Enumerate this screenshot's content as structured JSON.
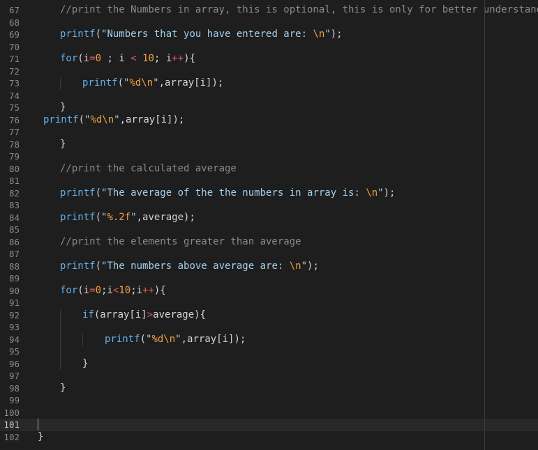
{
  "editor": {
    "colors": {
      "background": "#1e1e1e",
      "line_number": "#8a8a8a",
      "current_line": "#282828",
      "indent_guide": "#3a3a3a",
      "comment": "#8a8a8a",
      "function": "#64b0ea",
      "string": "#a3cfec",
      "escape_and_format": "#f0a040",
      "operator": "#e05c5c",
      "plain": "#d4d4d4"
    },
    "current_line": 101,
    "lines": [
      {
        "n": 67,
        "indent": 1,
        "tokens": [
          {
            "t": "//print the Numbers in array, this is optional, this is only for better understanding",
            "k": "comment"
          }
        ]
      },
      {
        "n": 68,
        "indent": 1,
        "tokens": []
      },
      {
        "n": 69,
        "indent": 1,
        "tokens": [
          {
            "t": "printf",
            "k": "function"
          },
          {
            "t": "(",
            "k": "plain"
          },
          {
            "t": "\"Numbers that you have entered are: ",
            "k": "string"
          },
          {
            "t": "\\n",
            "k": "escape_and_format"
          },
          {
            "t": "\"",
            "k": "string"
          },
          {
            "t": ");",
            "k": "plain"
          }
        ]
      },
      {
        "n": 70,
        "indent": 1,
        "tokens": []
      },
      {
        "n": 71,
        "indent": 1,
        "tokens": [
          {
            "t": "for",
            "k": "function"
          },
          {
            "t": "(i",
            "k": "plain"
          },
          {
            "t": "=",
            "k": "operator"
          },
          {
            "t": "0",
            "k": "escape_and_format"
          },
          {
            "t": " ; i ",
            "k": "plain"
          },
          {
            "t": "<",
            "k": "operator"
          },
          {
            "t": " ",
            "k": "plain"
          },
          {
            "t": "10",
            "k": "escape_and_format"
          },
          {
            "t": "; i",
            "k": "plain"
          },
          {
            "t": "++",
            "k": "operator"
          },
          {
            "t": "){",
            "k": "plain"
          }
        ]
      },
      {
        "n": 72,
        "indent": 1,
        "tokens": []
      },
      {
        "n": 73,
        "indent": 2,
        "tokens": [
          {
            "t": "printf",
            "k": "function"
          },
          {
            "t": "(",
            "k": "plain"
          },
          {
            "t": "\"",
            "k": "string"
          },
          {
            "t": "%d\\n",
            "k": "escape_and_format"
          },
          {
            "t": "\"",
            "k": "string"
          },
          {
            "t": ",array[i]);",
            "k": "plain"
          }
        ]
      },
      {
        "n": 74,
        "indent": 1,
        "tokens": []
      },
      {
        "n": 75,
        "indent": 1,
        "tokens": [
          {
            "t": "}",
            "k": "plain"
          }
        ]
      },
      {
        "n": 76,
        "indent": 0.25,
        "tokens": [
          {
            "t": "printf",
            "k": "function"
          },
          {
            "t": "(",
            "k": "plain"
          },
          {
            "t": "\"",
            "k": "string"
          },
          {
            "t": "%d\\n",
            "k": "escape_and_format"
          },
          {
            "t": "\"",
            "k": "string"
          },
          {
            "t": ",array[i]);",
            "k": "plain"
          }
        ]
      },
      {
        "n": 77,
        "indent": 1,
        "tokens": []
      },
      {
        "n": 78,
        "indent": 1,
        "tokens": [
          {
            "t": "}",
            "k": "plain"
          }
        ]
      },
      {
        "n": 79,
        "indent": 1,
        "tokens": []
      },
      {
        "n": 80,
        "indent": 1,
        "tokens": [
          {
            "t": "//print the calculated average",
            "k": "comment"
          }
        ]
      },
      {
        "n": 81,
        "indent": 1,
        "tokens": []
      },
      {
        "n": 82,
        "indent": 1,
        "tokens": [
          {
            "t": "printf",
            "k": "function"
          },
          {
            "t": "(",
            "k": "plain"
          },
          {
            "t": "\"The average of the the numbers in array is: ",
            "k": "string"
          },
          {
            "t": "\\n",
            "k": "escape_and_format"
          },
          {
            "t": "\"",
            "k": "string"
          },
          {
            "t": ");",
            "k": "plain"
          }
        ]
      },
      {
        "n": 83,
        "indent": 1,
        "tokens": []
      },
      {
        "n": 84,
        "indent": 1,
        "tokens": [
          {
            "t": "printf",
            "k": "function"
          },
          {
            "t": "(",
            "k": "plain"
          },
          {
            "t": "\"",
            "k": "string"
          },
          {
            "t": "%.2f",
            "k": "escape_and_format"
          },
          {
            "t": "\"",
            "k": "string"
          },
          {
            "t": ",average);",
            "k": "plain"
          }
        ]
      },
      {
        "n": 85,
        "indent": 1,
        "tokens": []
      },
      {
        "n": 86,
        "indent": 1,
        "tokens": [
          {
            "t": "//print the elements greater than average",
            "k": "comment"
          }
        ]
      },
      {
        "n": 87,
        "indent": 1,
        "tokens": []
      },
      {
        "n": 88,
        "indent": 1,
        "tokens": [
          {
            "t": "printf",
            "k": "function"
          },
          {
            "t": "(",
            "k": "plain"
          },
          {
            "t": "\"The numbers above average are: ",
            "k": "string"
          },
          {
            "t": "\\n",
            "k": "escape_and_format"
          },
          {
            "t": "\"",
            "k": "string"
          },
          {
            "t": ");",
            "k": "plain"
          }
        ]
      },
      {
        "n": 89,
        "indent": 1,
        "tokens": []
      },
      {
        "n": 90,
        "indent": 1,
        "tokens": [
          {
            "t": "for",
            "k": "function"
          },
          {
            "t": "(i",
            "k": "plain"
          },
          {
            "t": "=",
            "k": "operator"
          },
          {
            "t": "0",
            "k": "escape_and_format"
          },
          {
            "t": ";i",
            "k": "plain"
          },
          {
            "t": "<",
            "k": "operator"
          },
          {
            "t": "10",
            "k": "escape_and_format"
          },
          {
            "t": ";i",
            "k": "plain"
          },
          {
            "t": "++",
            "k": "operator"
          },
          {
            "t": "){",
            "k": "plain"
          }
        ]
      },
      {
        "n": 91,
        "indent": 1,
        "tokens": []
      },
      {
        "n": 92,
        "indent": 2,
        "tokens": [
          {
            "t": "if",
            "k": "function"
          },
          {
            "t": "(array[i]",
            "k": "plain"
          },
          {
            "t": ">",
            "k": "operator"
          },
          {
            "t": "average){",
            "k": "plain"
          }
        ]
      },
      {
        "n": 93,
        "indent": 2,
        "tokens": []
      },
      {
        "n": 94,
        "indent": 3,
        "tokens": [
          {
            "t": "printf",
            "k": "function"
          },
          {
            "t": "(",
            "k": "plain"
          },
          {
            "t": "\"",
            "k": "string"
          },
          {
            "t": "%d\\n",
            "k": "escape_and_format"
          },
          {
            "t": "\"",
            "k": "string"
          },
          {
            "t": ",array[i]);",
            "k": "plain"
          }
        ]
      },
      {
        "n": 95,
        "indent": 2,
        "tokens": []
      },
      {
        "n": 96,
        "indent": 2,
        "tokens": [
          {
            "t": "}",
            "k": "plain"
          }
        ]
      },
      {
        "n": 97,
        "indent": 1,
        "tokens": []
      },
      {
        "n": 98,
        "indent": 1,
        "tokens": [
          {
            "t": "}",
            "k": "plain"
          }
        ]
      },
      {
        "n": 99,
        "indent": 1,
        "tokens": []
      },
      {
        "n": 100,
        "indent": 1,
        "tokens": []
      },
      {
        "n": 101,
        "indent": 0,
        "tokens": []
      },
      {
        "n": 102,
        "indent": 0,
        "tokens": [
          {
            "t": "}",
            "k": "plain"
          }
        ]
      }
    ]
  }
}
